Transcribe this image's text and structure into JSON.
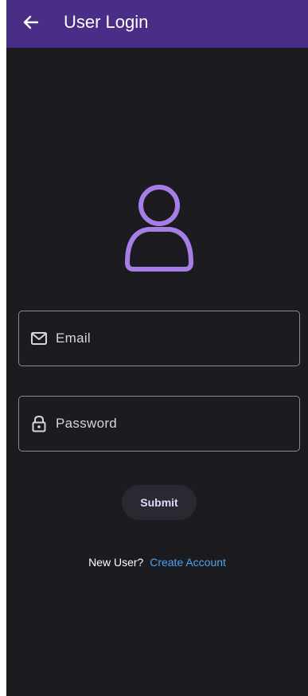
{
  "app_bar": {
    "title": "User Login",
    "back_icon": "arrow-back-icon",
    "background_color": "#4a2d87"
  },
  "avatar": {
    "icon": "person-outline-icon",
    "color": "#a77ee8"
  },
  "form": {
    "email": {
      "icon": "mail-icon",
      "placeholder": "Email"
    },
    "password": {
      "icon": "lock-icon",
      "placeholder": "Password"
    },
    "submit_label": "Submit"
  },
  "signup": {
    "prompt": "New User?",
    "link_label": "Create Account",
    "link_color": "#4aa3f0"
  }
}
